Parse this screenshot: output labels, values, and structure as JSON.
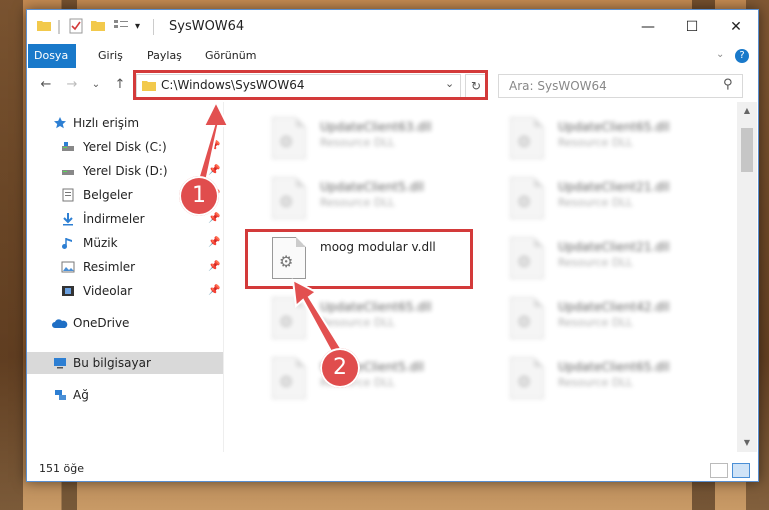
{
  "window": {
    "title": "SysWOW64",
    "controls": {
      "minimize": "—",
      "maximize": "☐",
      "close": "✕"
    }
  },
  "ribbon": {
    "tabs": [
      "Dosya",
      "Giriş",
      "Paylaş",
      "Görünüm"
    ],
    "help": "?"
  },
  "nav": {
    "back": "←",
    "forward": "→",
    "recent": "⌄",
    "up": "↑",
    "address": "C:\\Windows\\SysWOW64",
    "dropdown": "⌄",
    "refresh": "↻",
    "search_placeholder": "Ara: SysWOW64",
    "search_icon": "⚲"
  },
  "sidebar": {
    "quick_access": "Hızlı erişim",
    "items": [
      {
        "label": "Yerel Disk (C:)",
        "icon": "drive-icon",
        "pinned": true
      },
      {
        "label": "Yerel Disk (D:)",
        "icon": "drive-icon",
        "pinned": true
      },
      {
        "label": "Belgeler",
        "icon": "documents-icon",
        "pinned": true
      },
      {
        "label": "İndirmeler",
        "icon": "downloads-icon",
        "pinned": true
      },
      {
        "label": "Müzik",
        "icon": "music-icon",
        "pinned": true
      },
      {
        "label": "Resimler",
        "icon": "pictures-icon",
        "pinned": true
      },
      {
        "label": "Videolar",
        "icon": "videos-icon",
        "pinned": true
      }
    ],
    "onedrive": "OneDrive",
    "this_pc": "Bu bilgisayar",
    "network": "Ağ"
  },
  "files": [
    {
      "name": "UpdateClient63.dll",
      "type": "Resource DLL",
      "blurred": true
    },
    {
      "name": "UpdateClient65.dll",
      "type": "Resource DLL",
      "blurred": true
    },
    {
      "name": "UpdateClient5.dll",
      "type": "Resource DLL",
      "blurred": true
    },
    {
      "name": "UpdateClient21.dll",
      "type": "Resource DLL",
      "blurred": true
    },
    {
      "name": "moog modular v.dll",
      "type": "",
      "blurred": false
    },
    {
      "name": "UpdateClient21.dll",
      "type": "Resource DLL",
      "blurred": true
    },
    {
      "name": "UpdateClient65.dll",
      "type": "Resource DLL",
      "blurred": true
    },
    {
      "name": "UpdateClient42.dll",
      "type": "Resource DLL",
      "blurred": true
    },
    {
      "name": "UpdateClient5.dll",
      "type": "Resource DLL",
      "blurred": true
    },
    {
      "name": "UpdateClient65.dll",
      "type": "Resource DLL",
      "blurred": true
    }
  ],
  "status": {
    "count": "151 öğe"
  },
  "annotations": {
    "step1": "1",
    "step2": "2"
  },
  "colors": {
    "accent": "#1979ca",
    "highlight": "#d33a3a",
    "badge": "#e04d4d"
  }
}
